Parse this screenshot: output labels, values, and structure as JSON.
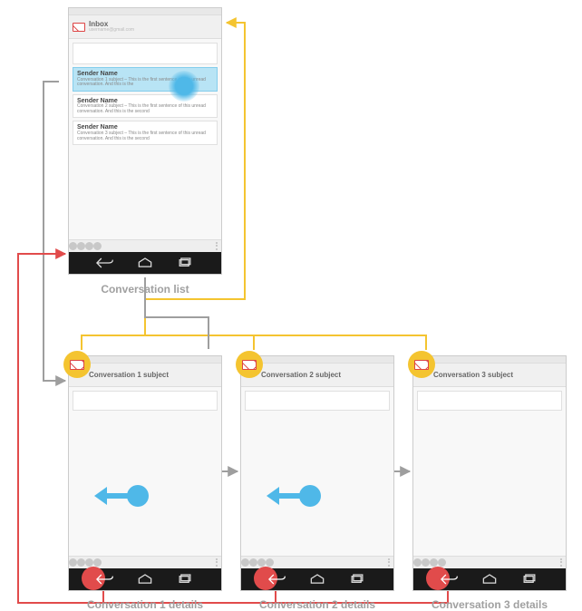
{
  "colors": {
    "up": "#f4c430",
    "back": "#e14b4b",
    "touch": "#4fb8e8",
    "nav": "#9e9e9e"
  },
  "top_phone": {
    "statusbar_title": "Inbox",
    "statusbar_subtitle": "username@gmail.com",
    "items": [
      {
        "sender": "Sender Name",
        "subject": "Conversation 1 subject – This is the first sentence of this unread conversation. And this is the"
      },
      {
        "sender": "Sender Name",
        "subject": "Conversation 2 subject – This is the first sentence of this unread conversation. And this is the second"
      },
      {
        "sender": "Sender Name",
        "subject": "Conversation 3 subject – This is the first sentence of this unread conversation. And this is the second"
      }
    ],
    "caption": "Conversation list"
  },
  "detail_1": {
    "title": "Conversation 1 subject",
    "caption": "Conversation 1 details"
  },
  "detail_2": {
    "title": "Conversation 2 subject",
    "caption": "Conversation 2 details"
  },
  "detail_3": {
    "title": "Conversation 3 subject",
    "caption": "Conversation 3 details"
  }
}
